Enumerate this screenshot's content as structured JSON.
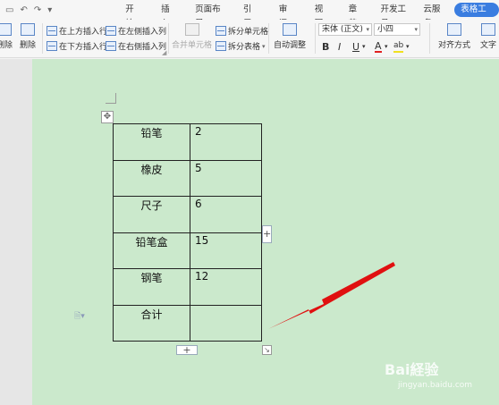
{
  "menu": {
    "tabs": [
      "开始",
      "插入",
      "页面布局",
      "引用",
      "审阅",
      "视图",
      "章节",
      "开发工具",
      "云服务",
      "表格工具"
    ],
    "active_tab": "表格工具"
  },
  "ribbon": {
    "delete_label_1": "删除",
    "delete_label_2": "删除",
    "insert_above": "在上方插入行",
    "insert_below": "在下方插入行",
    "insert_left": "在左侧插入列",
    "insert_right": "在右侧插入列",
    "merge_cells": "合并单元格",
    "split_cells": "拆分单元格",
    "split_table": "拆分表格",
    "autofit": "自动调整",
    "font_name": "宋体 (正文)",
    "font_size": "小四",
    "bold": "B",
    "italic": "I",
    "underline": "U",
    "font_color": "A",
    "highlight": "ab",
    "align": "对齐方式",
    "text_dir": "文字"
  },
  "table": {
    "rows": [
      {
        "name": "铅笔",
        "value": "2"
      },
      {
        "name": "橡皮",
        "value": "5"
      },
      {
        "name": "尺子",
        "value": "6"
      },
      {
        "name": "铅笔盒",
        "value": "15"
      },
      {
        "name": "钢笔",
        "value": "12"
      },
      {
        "name": "合计",
        "value": ""
      }
    ]
  },
  "controls": {
    "add_column": "+",
    "add_row": "+",
    "move_handle": "✥",
    "resize_handle": "↘"
  },
  "watermark": {
    "brand": "Bai経验",
    "url": "jingyan.baidu.com"
  },
  "colors": {
    "doc_background": "#cbe9cc",
    "accent": "#3a7de0",
    "arrow": "#e01010"
  }
}
